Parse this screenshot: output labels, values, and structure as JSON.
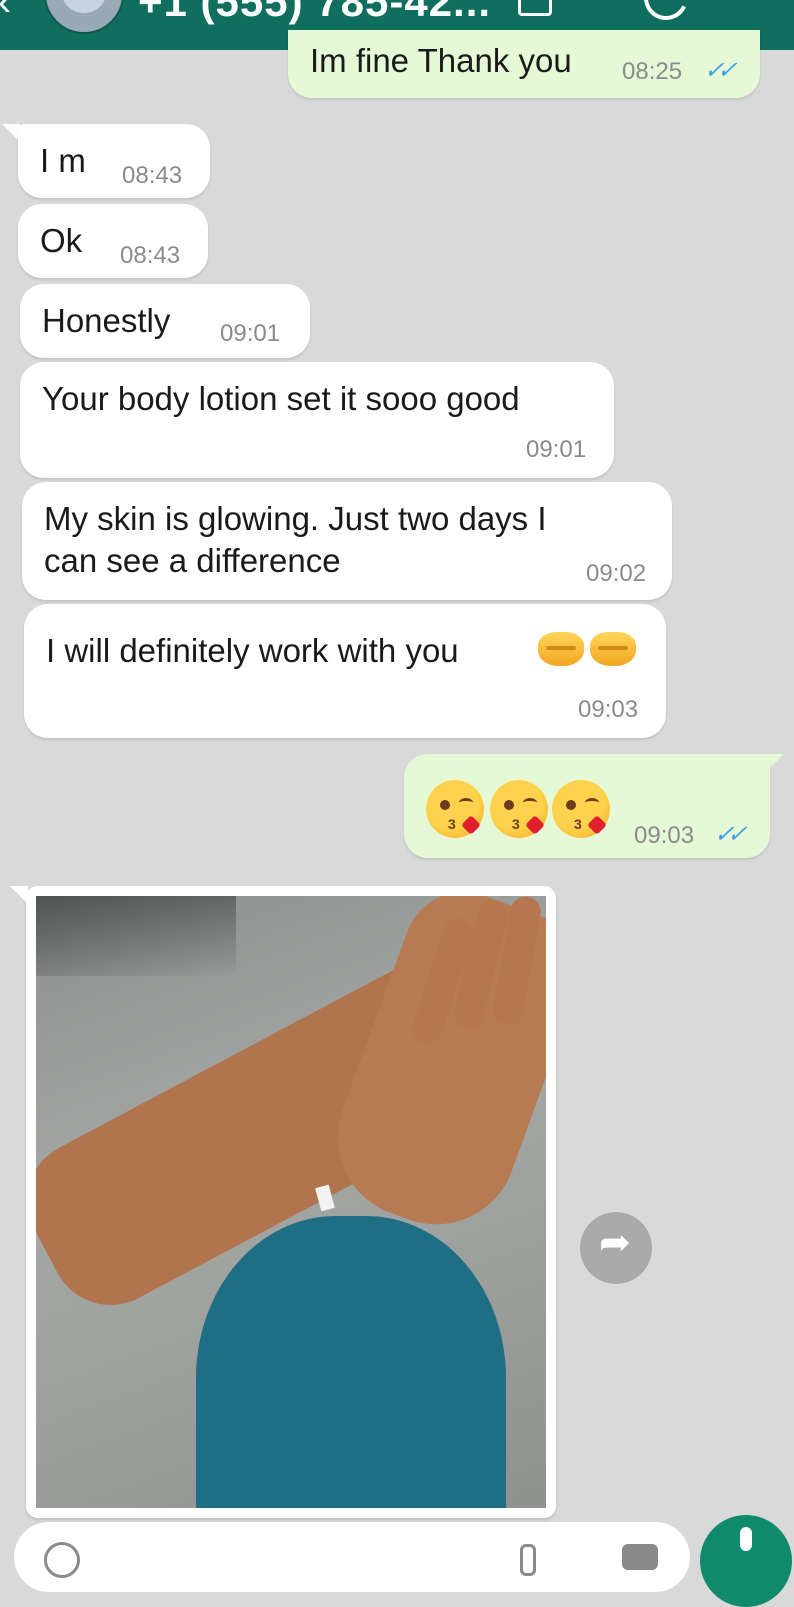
{
  "header": {
    "contact": "+1 (555) 785-42...",
    "back_icon": "arrow-left-icon",
    "video_icon": "video-icon",
    "call_icon": "phone-icon",
    "menu_icon": "more-icon",
    "color": "#0f6e5e"
  },
  "messages": [
    {
      "dir": "out",
      "text": "Im fine Thank you",
      "time": "08:25",
      "read": true
    },
    {
      "dir": "in",
      "text": "I m",
      "time": "08:43"
    },
    {
      "dir": "in",
      "text": "Ok",
      "time": "08:43"
    },
    {
      "dir": "in",
      "text": "Honestly",
      "time": "09:01"
    },
    {
      "dir": "in",
      "text": "Your body lotion set it sooo good",
      "time": "09:01"
    },
    {
      "dir": "in",
      "text_line1": "My skin is glowing. Just two days I",
      "text_line2": "can see a difference",
      "time": "09:02"
    },
    {
      "dir": "in",
      "text": "I will definitely work with you",
      "emoji": "handshake-icon",
      "time": "09:03"
    },
    {
      "dir": "out",
      "emoji": "kissing-heart-icon",
      "time": "09:03",
      "read": true
    },
    {
      "dir": "in",
      "type": "photo",
      "subject": "hand-photo"
    }
  ],
  "forward_icon": "share-icon",
  "input_bar": {
    "emoji_icon": "emoji-icon",
    "attach_icon": "paperclip-icon",
    "camera_icon": "camera-icon",
    "mic_icon": "microphone-icon",
    "accent": "#0f8a6c"
  },
  "colors": {
    "background": "#d9d9d9",
    "incoming": "#ffffff",
    "outgoing": "#e6f9d6",
    "read_ticks": "#3aa0e6"
  }
}
